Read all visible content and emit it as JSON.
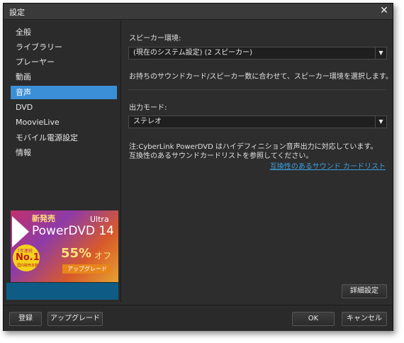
{
  "window": {
    "title": "設定"
  },
  "sidebar": {
    "items": [
      {
        "label": "全般"
      },
      {
        "label": "ライブラリー"
      },
      {
        "label": "プレーヤー"
      },
      {
        "label": "動画"
      },
      {
        "label": "音声"
      },
      {
        "label": "DVD"
      },
      {
        "label": "MoovieLive"
      },
      {
        "label": "モバイル電源設定"
      },
      {
        "label": "情報"
      }
    ],
    "active_index": 4
  },
  "ad": {
    "badge_new": "新発売",
    "ultra": "Ultra",
    "product": "PowerDVD 14",
    "years": "7年連続",
    "no1": "No.1",
    "no1_sub": "国内販売本数",
    "discount": "55%",
    "off": "オフ",
    "upgrade": "アップグレード"
  },
  "main": {
    "speaker_label": "スピーカー環境:",
    "speaker_value": "(現在のシステム設定) (2 スピーカー)",
    "speaker_help": "お持ちのサウンドカード/スピーカー数に合わせて、スピーカー環境を選択します。",
    "output_label": "出力モード:",
    "output_value": "ステレオ",
    "note_line1": "注:CyberLink PowerDVD はハイデフィニション音声出力に対応しています。",
    "note_line2": "互換性のあるサウンドカードリストを参照してください。",
    "compat_link": "互換性のあるサウンド カードリスト",
    "advanced_button": "詳細設定"
  },
  "footer": {
    "register": "登録",
    "upgrade": "アップグレード",
    "ok": "OK",
    "cancel": "キャンセル"
  }
}
